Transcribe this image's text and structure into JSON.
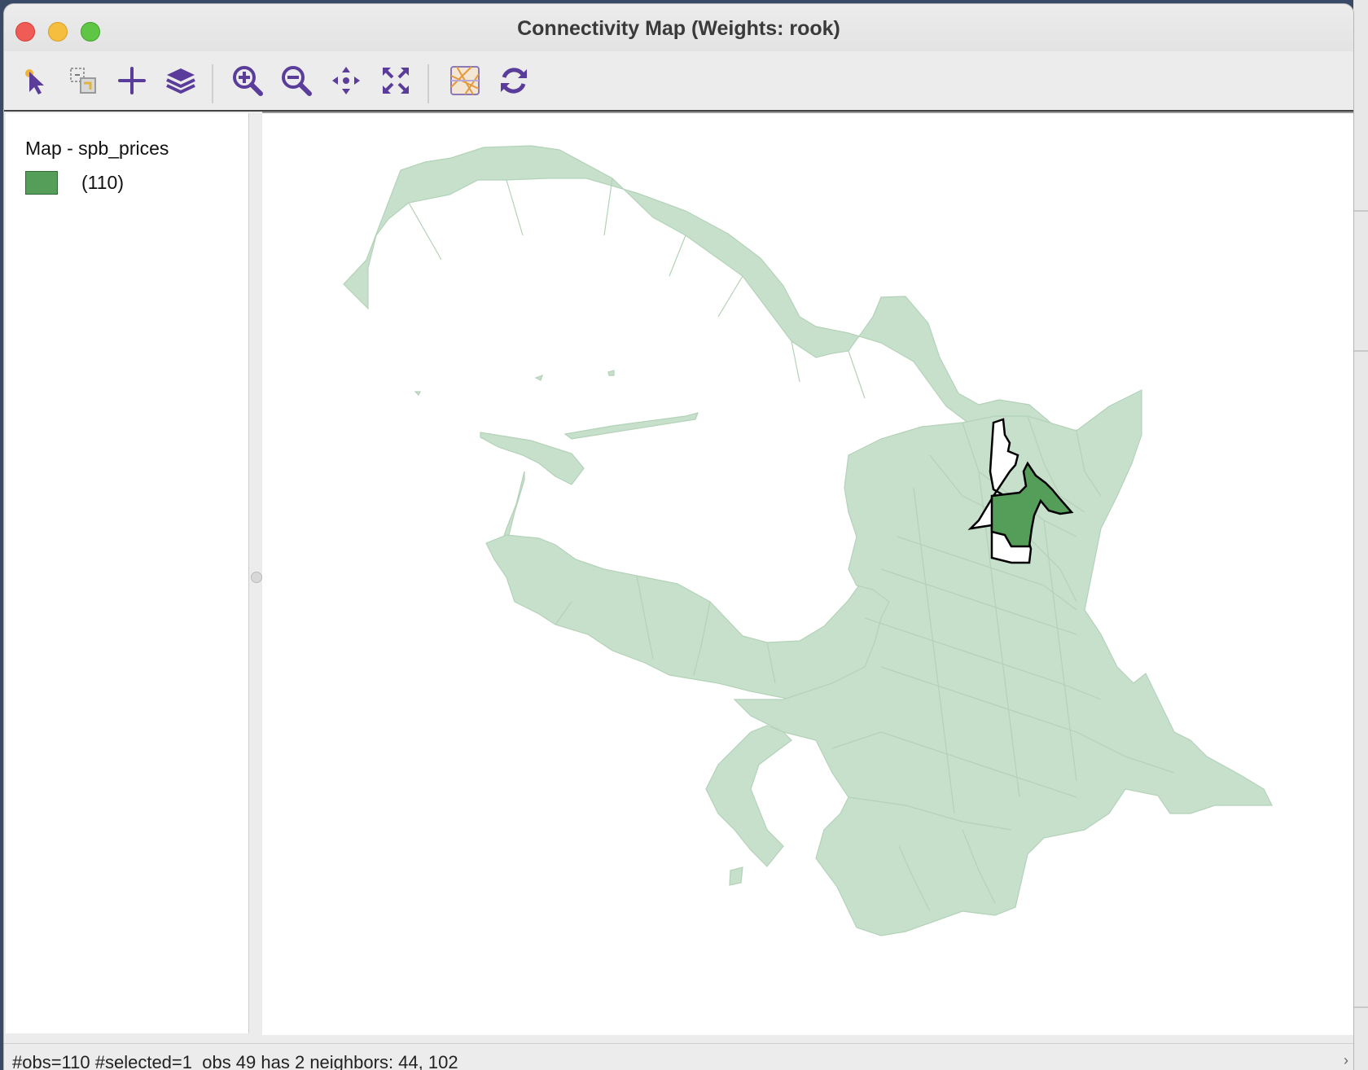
{
  "window": {
    "title": "Connectivity Map (Weights: rook)"
  },
  "toolbar": {
    "tools": [
      {
        "name": "select-tool-icon"
      },
      {
        "name": "selection-mode-icon"
      },
      {
        "name": "add-layer-icon"
      },
      {
        "name": "layers-icon"
      },
      {
        "name": "zoom-in-icon"
      },
      {
        "name": "zoom-out-icon"
      },
      {
        "name": "pan-icon"
      },
      {
        "name": "full-extent-icon"
      },
      {
        "name": "basemap-icon"
      },
      {
        "name": "refresh-icon"
      }
    ],
    "accent": "#5a3d9a"
  },
  "legend": {
    "title": "Map - spb_prices",
    "items": [
      {
        "label": "(110)",
        "color": "#559e5a"
      }
    ]
  },
  "map": {
    "fill_color": "#c7e0cb",
    "selected_color": "#559e5a",
    "neighbor_fill": "#ffffff"
  },
  "status": {
    "text": "#obs=110 #selected=1  obs 49 has 2 neighbors: 44, 102"
  }
}
